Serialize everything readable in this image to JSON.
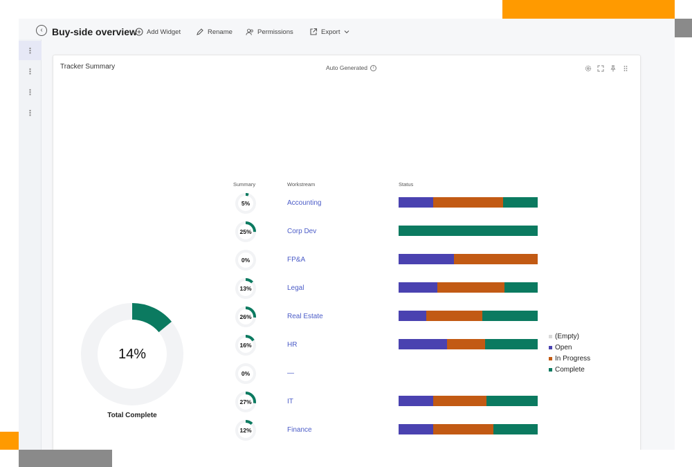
{
  "toolbar": {
    "title": "Buy-side overview",
    "add_widget": "Add Widget",
    "rename": "Rename",
    "permissions": "Permissions",
    "export": "Export"
  },
  "widget": {
    "title": "Tracker Summary",
    "auto_generated": "Auto Generated",
    "total_percent": "14%",
    "total_value": 0.14,
    "total_label": "Total Complete",
    "headers": {
      "summary": "Summary",
      "workstream": "Workstream",
      "status": "Status"
    },
    "rows": [
      {
        "pct": "5%",
        "value": 0.05,
        "name": "Accounting",
        "open": 0.25,
        "progress": 0.5,
        "complete": 0.25
      },
      {
        "pct": "25%",
        "value": 0.25,
        "name": "Corp Dev",
        "open": 0,
        "progress": 0,
        "complete": 1.0
      },
      {
        "pct": "0%",
        "value": 0,
        "name": "FP&A",
        "open": 0.4,
        "progress": 0.6,
        "complete": 0
      },
      {
        "pct": "13%",
        "value": 0.13,
        "name": "Legal",
        "open": 0.28,
        "progress": 0.48,
        "complete": 0.24
      },
      {
        "pct": "26%",
        "value": 0.26,
        "name": "Real Estate",
        "open": 0.2,
        "progress": 0.4,
        "complete": 0.4
      },
      {
        "pct": "16%",
        "value": 0.16,
        "name": "HR",
        "open": 0.35,
        "progress": 0.27,
        "complete": 0.38
      },
      {
        "pct": "0%",
        "value": 0,
        "name": "—",
        "open": 0,
        "progress": 0,
        "complete": 0
      },
      {
        "pct": "27%",
        "value": 0.27,
        "name": "IT",
        "open": 0.25,
        "progress": 0.38,
        "complete": 0.37
      },
      {
        "pct": "12%",
        "value": 0.12,
        "name": "Finance",
        "open": 0.25,
        "progress": 0.43,
        "complete": 0.32
      }
    ],
    "legend": [
      {
        "label": "(Empty)",
        "color": "#d9d9d9"
      },
      {
        "label": "Open",
        "color": "#4a42b0"
      },
      {
        "label": "In Progress",
        "color": "#c25a14"
      },
      {
        "label": "Complete",
        "color": "#0b7a60"
      }
    ]
  },
  "colors": {
    "open": "#4a42b0",
    "progress": "#c25a14",
    "complete": "#0b7a60",
    "track": "#f2f3f5"
  }
}
